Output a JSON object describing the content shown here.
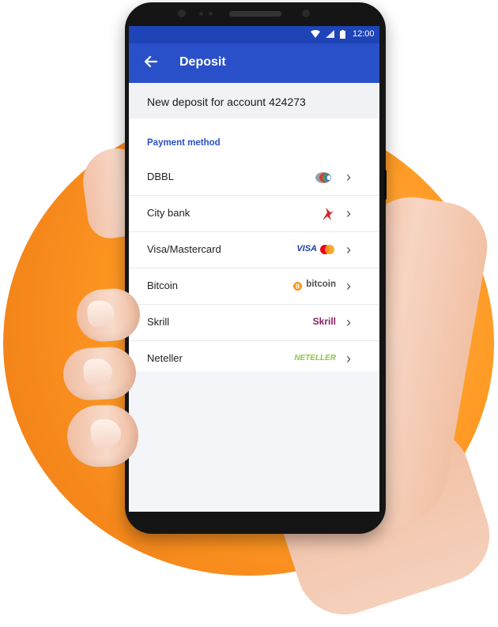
{
  "status_bar": {
    "time": "12:00"
  },
  "app_bar": {
    "back_icon": "arrow-left-icon",
    "title": "Deposit"
  },
  "account_line": "New deposit for account 424273",
  "payment": {
    "section_label": "Payment method",
    "methods": [
      {
        "label": "DBBL",
        "logo": "dbbl-logo"
      },
      {
        "label": "City bank",
        "logo": "city-bank-logo"
      },
      {
        "label": "Visa/Mastercard",
        "logo": "visa-mastercard-logo",
        "logo_text": "VISA"
      },
      {
        "label": "Bitcoin",
        "logo": "bitcoin-logo",
        "logo_text": "bitcoin"
      },
      {
        "label": "Skrill",
        "logo": "skrill-logo",
        "logo_text": "Skrill"
      },
      {
        "label": "Neteller",
        "logo": "neteller-logo",
        "logo_text": "NETELLER"
      }
    ]
  },
  "colors": {
    "brand_blue": "#2a50c9",
    "background_orange": "#f5861a",
    "visa_blue": "#1a3fa8",
    "bitcoin_orange": "#f7931a",
    "skrill_purple": "#862165",
    "neteller_green": "#8dc63f"
  }
}
